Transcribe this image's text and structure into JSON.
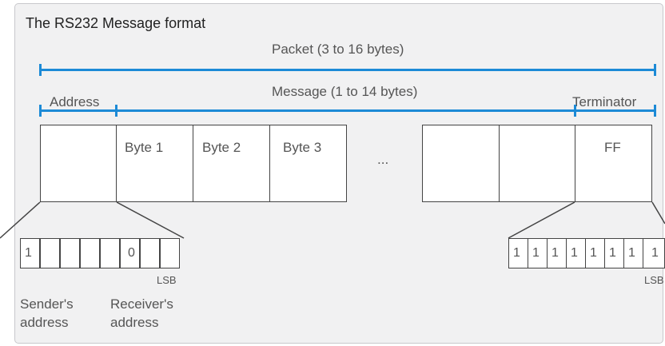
{
  "title": "The RS232 Message format",
  "packet_label": "Packet (3 to 16 bytes)",
  "message_label": "Message (1 to 14 bytes)",
  "address_label": "Address",
  "terminator_label": "Terminator",
  "bytes": {
    "byte1": "Byte 1",
    "byte2": "Byte 2",
    "byte3": "Byte 3",
    "ellipsis": "...",
    "ff": "FF"
  },
  "address_bits": {
    "bit0": "1",
    "bit5": "0",
    "lsb": "LSB"
  },
  "terminator_bits": {
    "b0": "1",
    "b1": "1",
    "b2": "1",
    "b3": "1",
    "b4": "1",
    "b5": "1",
    "b6": "1",
    "b7": "1",
    "lsb": "LSB"
  },
  "captions": {
    "sender": "Sender's\naddress",
    "receiver": "Receiver's\naddress"
  },
  "colors": {
    "accent_blue": "#1c8ad6",
    "panel_bg": "#f1f1f2",
    "line": "#444444"
  }
}
